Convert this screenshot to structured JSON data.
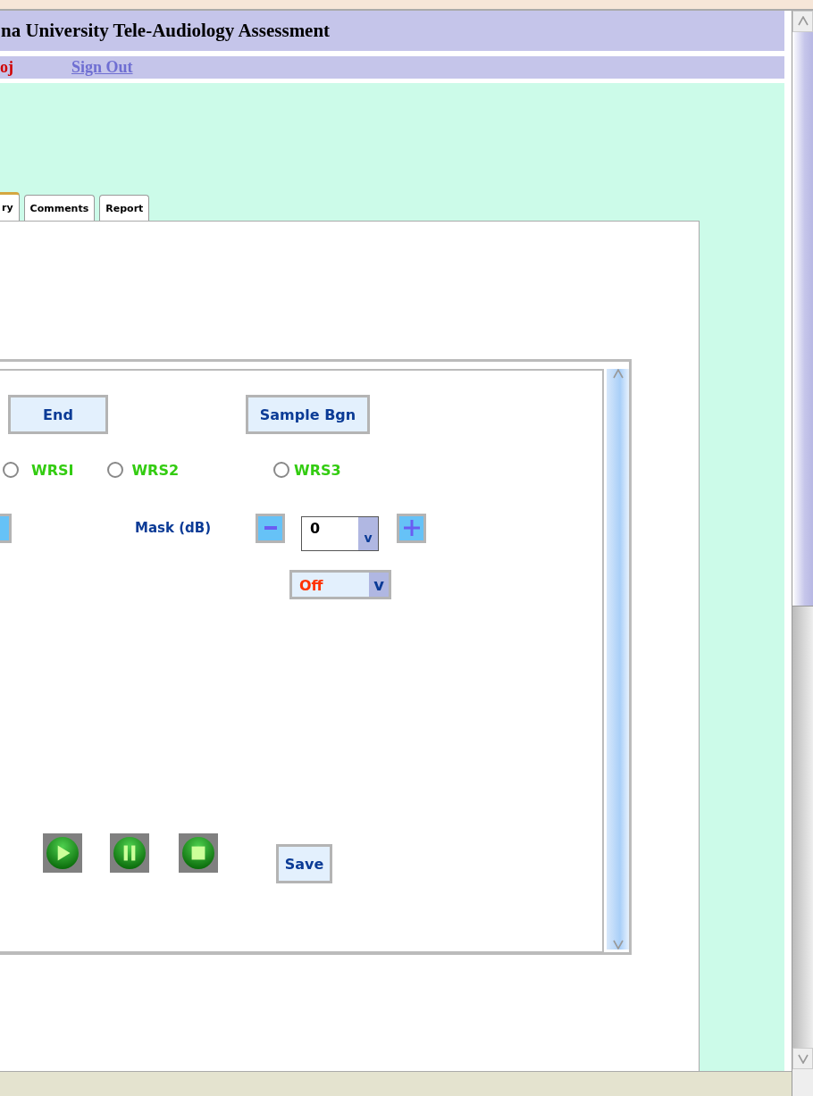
{
  "header": {
    "title": "na University Tele-Audiology Assessment"
  },
  "user_bar": {
    "user": "oj",
    "sign_out": "Sign Out"
  },
  "tabs": [
    {
      "label": "ry",
      "selected": true
    },
    {
      "label": "Comments",
      "selected": false
    },
    {
      "label": "Report",
      "selected": false
    }
  ],
  "panel": {
    "buttons": [
      {
        "label": "End"
      },
      {
        "label": "Sample Bgn"
      }
    ],
    "tests": [
      {
        "label": "WRSI",
        "selected": false
      },
      {
        "label": "WRS2",
        "selected": false
      },
      {
        "label": "WRS3",
        "selected": false
      }
    ],
    "mask": {
      "label": "Mask (dB)",
      "value": "0",
      "toggle": "v"
    },
    "mode_select": {
      "value": "Off",
      "toggle": "v"
    },
    "player": [
      {
        "kind": "play"
      },
      {
        "kind": "pause"
      },
      {
        "kind": "stop"
      }
    ],
    "save": {
      "label": "Save"
    }
  }
}
